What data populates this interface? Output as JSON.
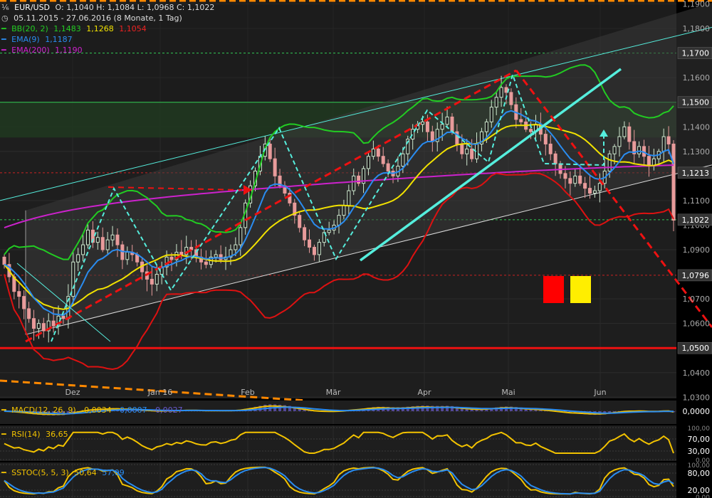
{
  "header": {
    "symbol": "EUR/USD",
    "ohlc": "O: 1,1040  H: 1,1084  L: 1,0968  C: 1,1022",
    "range": "05.11.2015 - 27.06.2016 (8 Monate, 1 Tag)",
    "bb_label": "BB(20, 2)",
    "bb_upper": "1,1483",
    "bb_mid": "1,1268",
    "bb_lower": "1,1054",
    "ema9_label": "EMA(9)",
    "ema9_value": "1,1187",
    "ema200_label": "EMA(200)",
    "ema200_value": "1,1190"
  },
  "colors": {
    "background": "#000000",
    "plot_bg": "#1e1e1e",
    "bb": "#22cc22",
    "bb_mid": "#f2e200",
    "bb_lower": "#dd1111",
    "ema9": "#2a8cf0",
    "ema200": "#cc22cc",
    "trend_cyan": "#55eedd",
    "resistance_red": "#ee1111",
    "top_orange": "#ff8800",
    "macd_fill": "#6a5acd",
    "osc_yellow": "#f2c200",
    "osc_blue": "#2a8cf0"
  },
  "chart_data": {
    "type": "candlestick",
    "title": "EUR/USD",
    "price_axis": {
      "range": [
        1.03,
        1.19
      ],
      "ticks": [
        "1,1900",
        "1,1800",
        "1,1600",
        "1,1400",
        "1,1300",
        "1,1100",
        "1,0900",
        "1,0700",
        "1,0600",
        "1,0400",
        "1,0300"
      ]
    },
    "x_axis_labels": [
      "Dez",
      "Jan 16",
      "Feb",
      "Mär",
      "Apr",
      "Mai",
      "Jun"
    ],
    "horizontal_levels": [
      {
        "value": 1.17,
        "label": "1,1700",
        "style": "green dashed"
      },
      {
        "value": 1.15,
        "label": "1,1500",
        "style": "green solid"
      },
      {
        "value": 1.1213,
        "label": "1,1213",
        "style": "red dashed"
      },
      {
        "value": 1.1022,
        "label": "1,1022",
        "style": "current price"
      },
      {
        "value": 1.0796,
        "label": "1,0796",
        "style": "red dashed"
      },
      {
        "value": 1.05,
        "label": "1,0500",
        "style": "red solid"
      }
    ],
    "hidden_tick": "1,1000",
    "close_series": [
      1.084,
      1.079,
      1.073,
      1.071,
      1.066,
      1.062,
      1.058,
      1.06,
      1.057,
      1.061,
      1.059,
      1.063,
      1.062,
      1.071,
      1.085,
      1.088,
      1.092,
      1.098,
      1.093,
      1.095,
      1.09,
      1.094,
      1.096,
      1.092,
      1.086,
      1.089,
      1.088,
      1.085,
      1.081,
      1.078,
      1.076,
      1.08,
      1.083,
      1.087,
      1.086,
      1.089,
      1.088,
      1.091,
      1.09,
      1.087,
      1.085,
      1.084,
      1.087,
      1.088,
      1.086,
      1.087,
      1.09,
      1.092,
      1.099,
      1.109,
      1.116,
      1.122,
      1.128,
      1.133,
      1.127,
      1.12,
      1.116,
      1.113,
      1.109,
      1.104,
      1.099,
      1.094,
      1.091,
      1.088,
      1.093,
      1.097,
      1.098,
      1.1,
      1.104,
      1.108,
      1.114,
      1.12,
      1.117,
      1.123,
      1.128,
      1.131,
      1.128,
      1.125,
      1.122,
      1.12,
      1.124,
      1.129,
      1.135,
      1.139,
      1.141,
      1.142,
      1.138,
      1.134,
      1.139,
      1.141,
      1.144,
      1.138,
      1.133,
      1.129,
      1.131,
      1.127,
      1.133,
      1.138,
      1.142,
      1.148,
      1.152,
      1.156,
      1.154,
      1.149,
      1.143,
      1.142,
      1.139,
      1.138,
      1.141,
      1.137,
      1.133,
      1.129,
      1.125,
      1.121,
      1.119,
      1.117,
      1.12,
      1.117,
      1.115,
      1.113,
      1.114,
      1.117,
      1.122,
      1.129,
      1.132,
      1.136,
      1.14,
      1.134,
      1.129,
      1.132,
      1.128,
      1.124,
      1.127,
      1.13,
      1.136,
      1.133,
      1.102
    ],
    "overlays": [
      "BB(20, 2) upper",
      "BB(20, 2) middle",
      "BB(20, 2) lower",
      "EMA(9)",
      "EMA(200)"
    ],
    "trendlines": [
      "upper channel",
      "lower channel",
      "cyan support",
      "red resistance"
    ],
    "indicators": [
      {
        "name": "MACD(12, 26, 9)",
        "values": [
          "-0,0034",
          "-0,0007",
          "-0,0027"
        ],
        "ticks": [
          "0,0000"
        ]
      },
      {
        "name": "RSI(14)",
        "value": "36,65",
        "ticks": [
          "100,00",
          "70,00",
          "30,00",
          "0,00"
        ]
      },
      {
        "name": "SSTOC(5, 5, 3)",
        "values": [
          "50,64",
          "57,09"
        ],
        "ticks": [
          "100,00",
          "80,00",
          "20,00",
          "0,00"
        ]
      }
    ]
  },
  "panels": {
    "macd_label": "MACD(12, 26, 9)",
    "macd_v1": "-0,0034",
    "macd_v2": "-0,0007",
    "macd_v3": "-0,0027",
    "rsi_label": "RSI(14)",
    "rsi_value": "36,65",
    "sstoc_label": "SSTOC(5, 5, 3)",
    "sstoc_v1": "50,64",
    "sstoc_v2": "57,09"
  }
}
